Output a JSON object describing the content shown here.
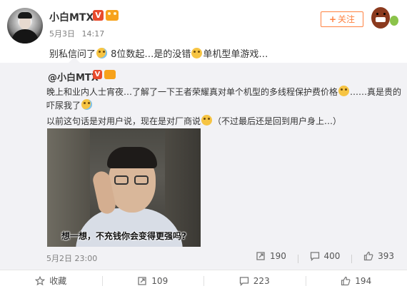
{
  "post": {
    "username": "小白MTX",
    "verified_badge": "V",
    "date": "5月3日",
    "time": "14:17",
    "follow_label": "关注",
    "text_part1": "别私信问了",
    "text_part2": " 8位数起…是的没错",
    "text_part3": "单机型单游戏…"
  },
  "repost": {
    "username": "@小白MTX",
    "verified_badge": "V",
    "line1_a": "晚上和业内人士宵夜…了解了一下王者荣耀真对单个机型的多线程保护费价格",
    "line1_b": "……真是贵的",
    "line2": "吓尿我了",
    "line3_a": "以前这句话是对用户说，现在是对厂商说",
    "line3_b": "（不过最后还是回到用户身上…）",
    "image_caption": "想一想，不充钱你会变得更强吗?",
    "date": "5月2日 23:00",
    "stats": {
      "reposts": "190",
      "comments": "400",
      "likes": "393"
    }
  },
  "footer": {
    "favorite_label": "收藏",
    "repost_count": "109",
    "comment_count": "223",
    "like_count": "194"
  },
  "colors": {
    "accent": "#ff8140",
    "verified": "#e84b2c",
    "vip": "#f7a21b",
    "repost_bg": "#f2f2f5"
  },
  "icons": [
    "favorite-icon",
    "repost-icon",
    "comment-icon",
    "like-icon",
    "laugh-cry-emoji",
    "grin-emoji",
    "laugh-emoji"
  ]
}
